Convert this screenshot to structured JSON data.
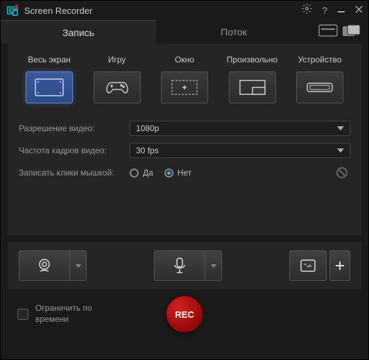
{
  "title": "Screen Recorder",
  "tabs": {
    "record": "Запись",
    "stream": "Поток"
  },
  "modes": {
    "fullscreen": "Весь экран",
    "game": "Игру",
    "window": "Окно",
    "custom": "Произвольно",
    "device": "Устройство"
  },
  "settings": {
    "resolution_label": "Разрешение видео:",
    "resolution_value": "1080p",
    "framerate_label": "Частота кадров видео:",
    "framerate_value": "30 fps",
    "clicks_label": "Записать клики мышкой:",
    "yes": "Да",
    "no": "Нет"
  },
  "limit_time_label": "Ограничить по времени",
  "rec_label": "REC"
}
